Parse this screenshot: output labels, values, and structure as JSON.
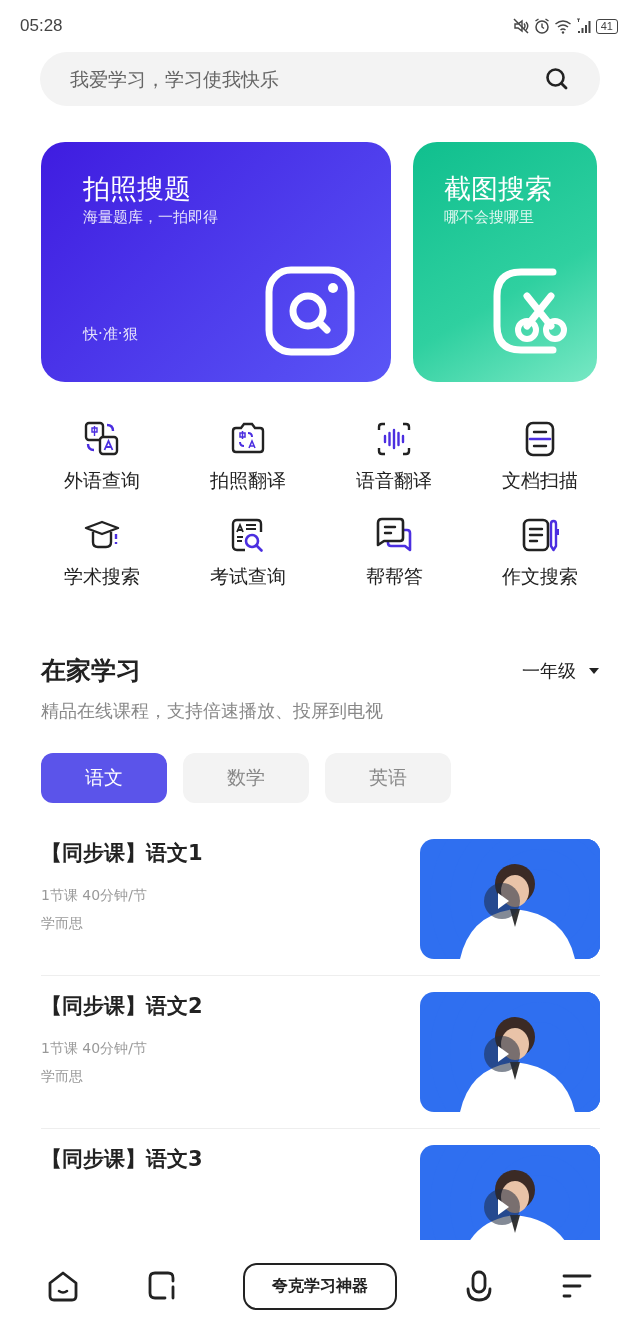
{
  "status_bar": {
    "time": "05:28",
    "battery": "41"
  },
  "search": {
    "placeholder": "我爱学习，学习使我快乐"
  },
  "cards": [
    {
      "title": "拍照搜题",
      "subtitle": "海量题库，一拍即得",
      "footer": "快·准·狠"
    },
    {
      "title": "截图搜索",
      "subtitle": "哪不会搜哪里"
    }
  ],
  "tools": [
    {
      "label": "外语查询"
    },
    {
      "label": "拍照翻译"
    },
    {
      "label": "语音翻译"
    },
    {
      "label": "文档扫描"
    },
    {
      "label": "学术搜索"
    },
    {
      "label": "考试查询"
    },
    {
      "label": "帮帮答"
    },
    {
      "label": "作文搜索"
    }
  ],
  "section": {
    "title": "在家学习",
    "subtitle": "精品在线课程，支持倍速播放、投屏到电视",
    "grade": "一年级"
  },
  "tabs": [
    {
      "label": "语文",
      "selected": true
    },
    {
      "label": "数学",
      "selected": false
    },
    {
      "label": "英语",
      "selected": false
    }
  ],
  "courses": [
    {
      "title": "【同步课】语文1",
      "meta": "1节课 40分钟/节",
      "provider": "学而思"
    },
    {
      "title": "【同步课】语文2",
      "meta": "1节课 40分钟/节",
      "provider": "学而思"
    },
    {
      "title": "【同步课】语文3"
    }
  ],
  "bottom_nav": {
    "button": "夸克学习神器"
  }
}
